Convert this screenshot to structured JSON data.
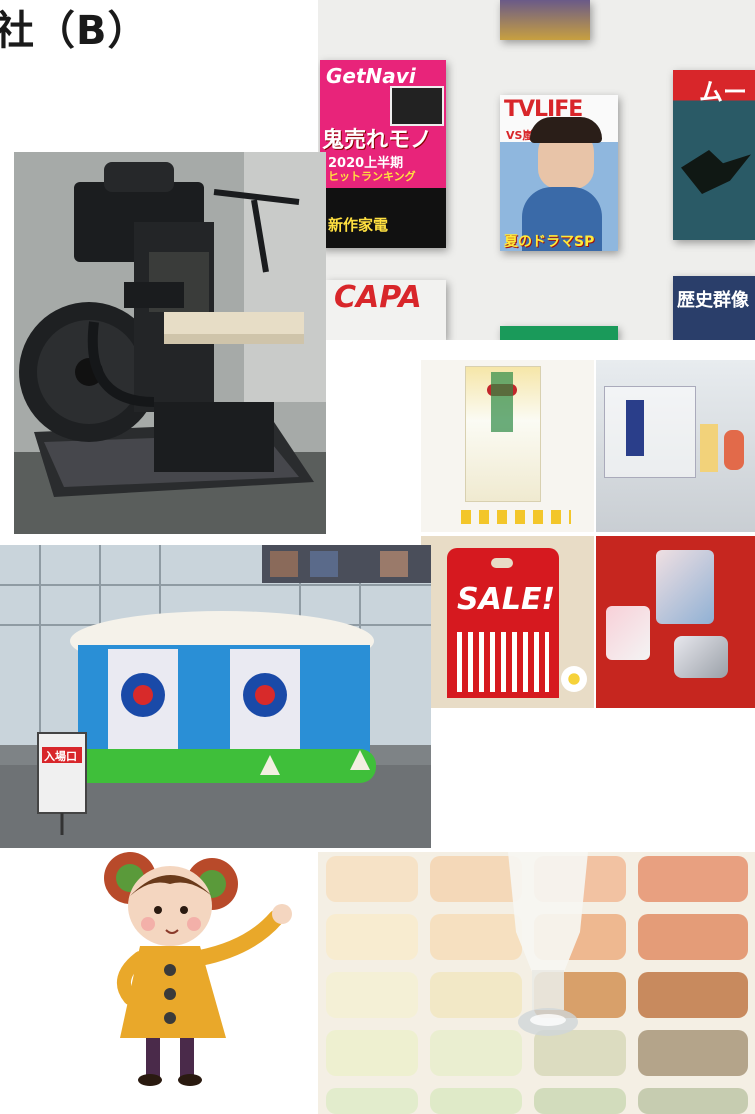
{
  "page": {
    "title": "社（B）"
  },
  "magazines": {
    "getnavi_title": "GetNavi",
    "getnavi_headline": "鬼売れモノ",
    "getnavi_sub": "2020上半期",
    "getnavi_sub2": "ヒットランキング",
    "getnavi_feature": "新作家電",
    "tvlife_title": "TVLIFE",
    "tvlife_vs": "VS嵐",
    "tvlife_feature": "夏のドラマSP",
    "mu_title": "ムー",
    "capa_title": "CAPA",
    "rekishi_title": "歴史群像"
  },
  "packaging": {
    "sale_text": "SALE!"
  },
  "atrium": {
    "sign_text": "入場口"
  },
  "colors": {
    "getnavi_pink": "#e8247a",
    "tvlife_red": "#d8262a",
    "sale_red": "#d6191f",
    "inflatable_blue": "#2a8fd6",
    "inflatable_green": "#3fbf3a"
  }
}
